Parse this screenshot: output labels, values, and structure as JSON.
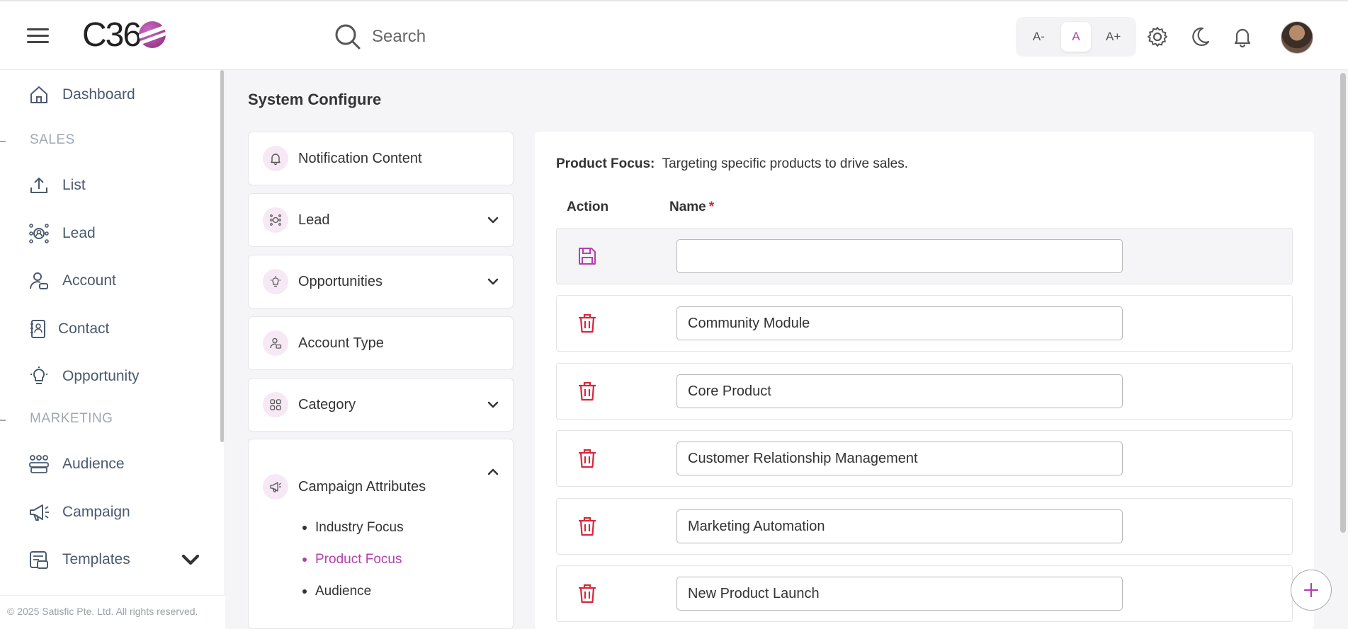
{
  "header": {
    "logo_text": "C36",
    "search_placeholder": "Search",
    "font_sizes": [
      "A-",
      "A",
      "A+"
    ],
    "active_font_size": "A"
  },
  "sidebar": {
    "items": [
      {
        "label": "Dashboard",
        "icon": "home-icon"
      },
      {
        "section": "SALES"
      },
      {
        "label": "List",
        "icon": "upload-icon"
      },
      {
        "label": "Lead",
        "icon": "lead-icon"
      },
      {
        "label": "Account",
        "icon": "account-icon"
      },
      {
        "label": "Contact",
        "icon": "contact-icon"
      },
      {
        "label": "Opportunity",
        "icon": "bulb-icon"
      },
      {
        "section": "MARKETING"
      },
      {
        "label": "Audience",
        "icon": "audience-icon"
      },
      {
        "label": "Campaign",
        "icon": "megaphone-icon"
      },
      {
        "label": "Templates",
        "icon": "templates-icon"
      }
    ],
    "footer": "© 2025 Satisfic Pte. Ltd. All rights reserved."
  },
  "main": {
    "title": "System Configure",
    "config_menu": [
      {
        "label": "Notification Content",
        "icon": "bell-icon"
      },
      {
        "label": "Lead",
        "icon": "lead-icon"
      },
      {
        "label": "Opportunities",
        "icon": "bulb-icon"
      },
      {
        "label": "Account Type",
        "icon": "account-icon"
      },
      {
        "label": "Category",
        "icon": "grid-icon"
      },
      {
        "label": "Campaign Attributes",
        "icon": "megaphone-icon"
      }
    ],
    "campaign_sub_items": [
      "Industry Focus",
      "Product Focus",
      "Audience"
    ],
    "active_sub_item": "Product Focus",
    "panel": {
      "desc_title": "Product Focus:",
      "desc_text": "Targeting specific products to drive sales.",
      "col_action": "Action",
      "col_name": "Name",
      "required_mark": "*",
      "new_value": "",
      "rows": [
        "Community Module",
        "Core Product",
        "Customer Relationship Management",
        "Marketing Automation",
        "New Product Launch"
      ]
    }
  },
  "colors": {
    "accent": "#b43fb0",
    "delete": "#d9263a"
  }
}
